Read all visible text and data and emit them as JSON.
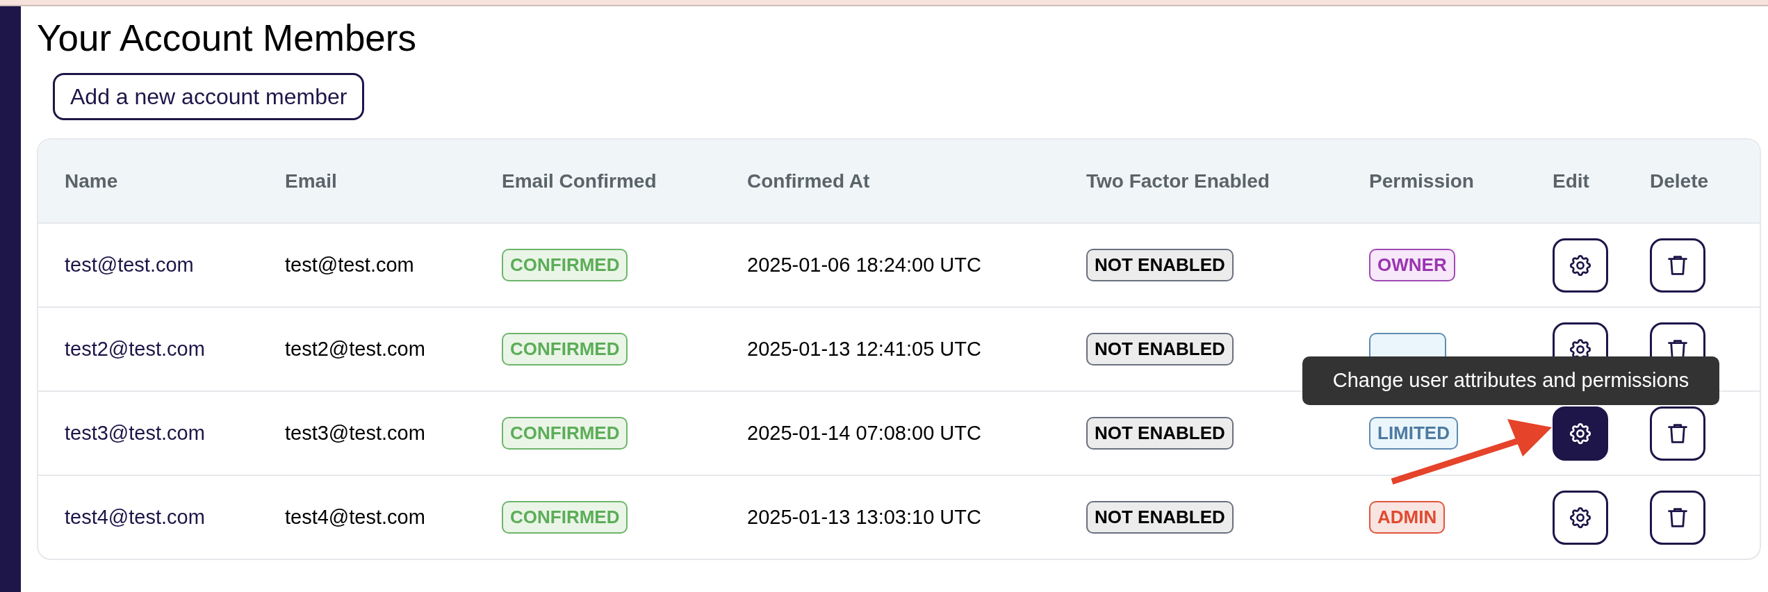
{
  "title": "Your Account Members",
  "add_button": "Add a new account member",
  "table": {
    "columns": [
      "Name",
      "Email",
      "Email Confirmed",
      "Confirmed At",
      "Two Factor Enabled",
      "Permission",
      "Edit",
      "Delete"
    ],
    "rows": [
      {
        "name": "test@test.com",
        "email": "test@test.com",
        "email_confirmed": {
          "label": "CONFIRMED",
          "kind": "confirmed"
        },
        "confirmed_at": "2025-01-06 18:24:00 UTC",
        "two_factor": {
          "label": "NOT ENABLED",
          "kind": "disabled"
        },
        "permission": {
          "label": "OWNER",
          "kind": "owner"
        },
        "edit": {
          "highlighted": false
        }
      },
      {
        "name": "test2@test.com",
        "email": "test2@test.com",
        "email_confirmed": {
          "label": "CONFIRMED",
          "kind": "confirmed"
        },
        "confirmed_at": "2025-01-13 12:41:05 UTC",
        "two_factor": {
          "label": "NOT ENABLED",
          "kind": "disabled"
        },
        "permission": {
          "kind": "limited"
        },
        "edit": {
          "highlighted": false
        }
      },
      {
        "name": "test3@test.com",
        "email": "test3@test.com",
        "email_confirmed": {
          "label": "CONFIRMED",
          "kind": "confirmed"
        },
        "confirmed_at": "2025-01-14 07:08:00 UTC",
        "two_factor": {
          "label": "NOT ENABLED",
          "kind": "disabled"
        },
        "permission": {
          "label": "LIMITED",
          "kind": "limited"
        },
        "edit": {
          "highlighted": true,
          "tooltip": "Change user attributes and permissions",
          "pointer_arrow": true
        }
      },
      {
        "name": "test4@test.com",
        "email": "test4@test.com",
        "email_confirmed": {
          "label": "CONFIRMED",
          "kind": "confirmed"
        },
        "confirmed_at": "2025-01-13 13:03:10 UTC",
        "two_factor": {
          "label": "NOT ENABLED",
          "kind": "disabled"
        },
        "permission": {
          "label": "ADMIN",
          "kind": "admin"
        },
        "edit": {
          "highlighted": false
        }
      }
    ]
  }
}
